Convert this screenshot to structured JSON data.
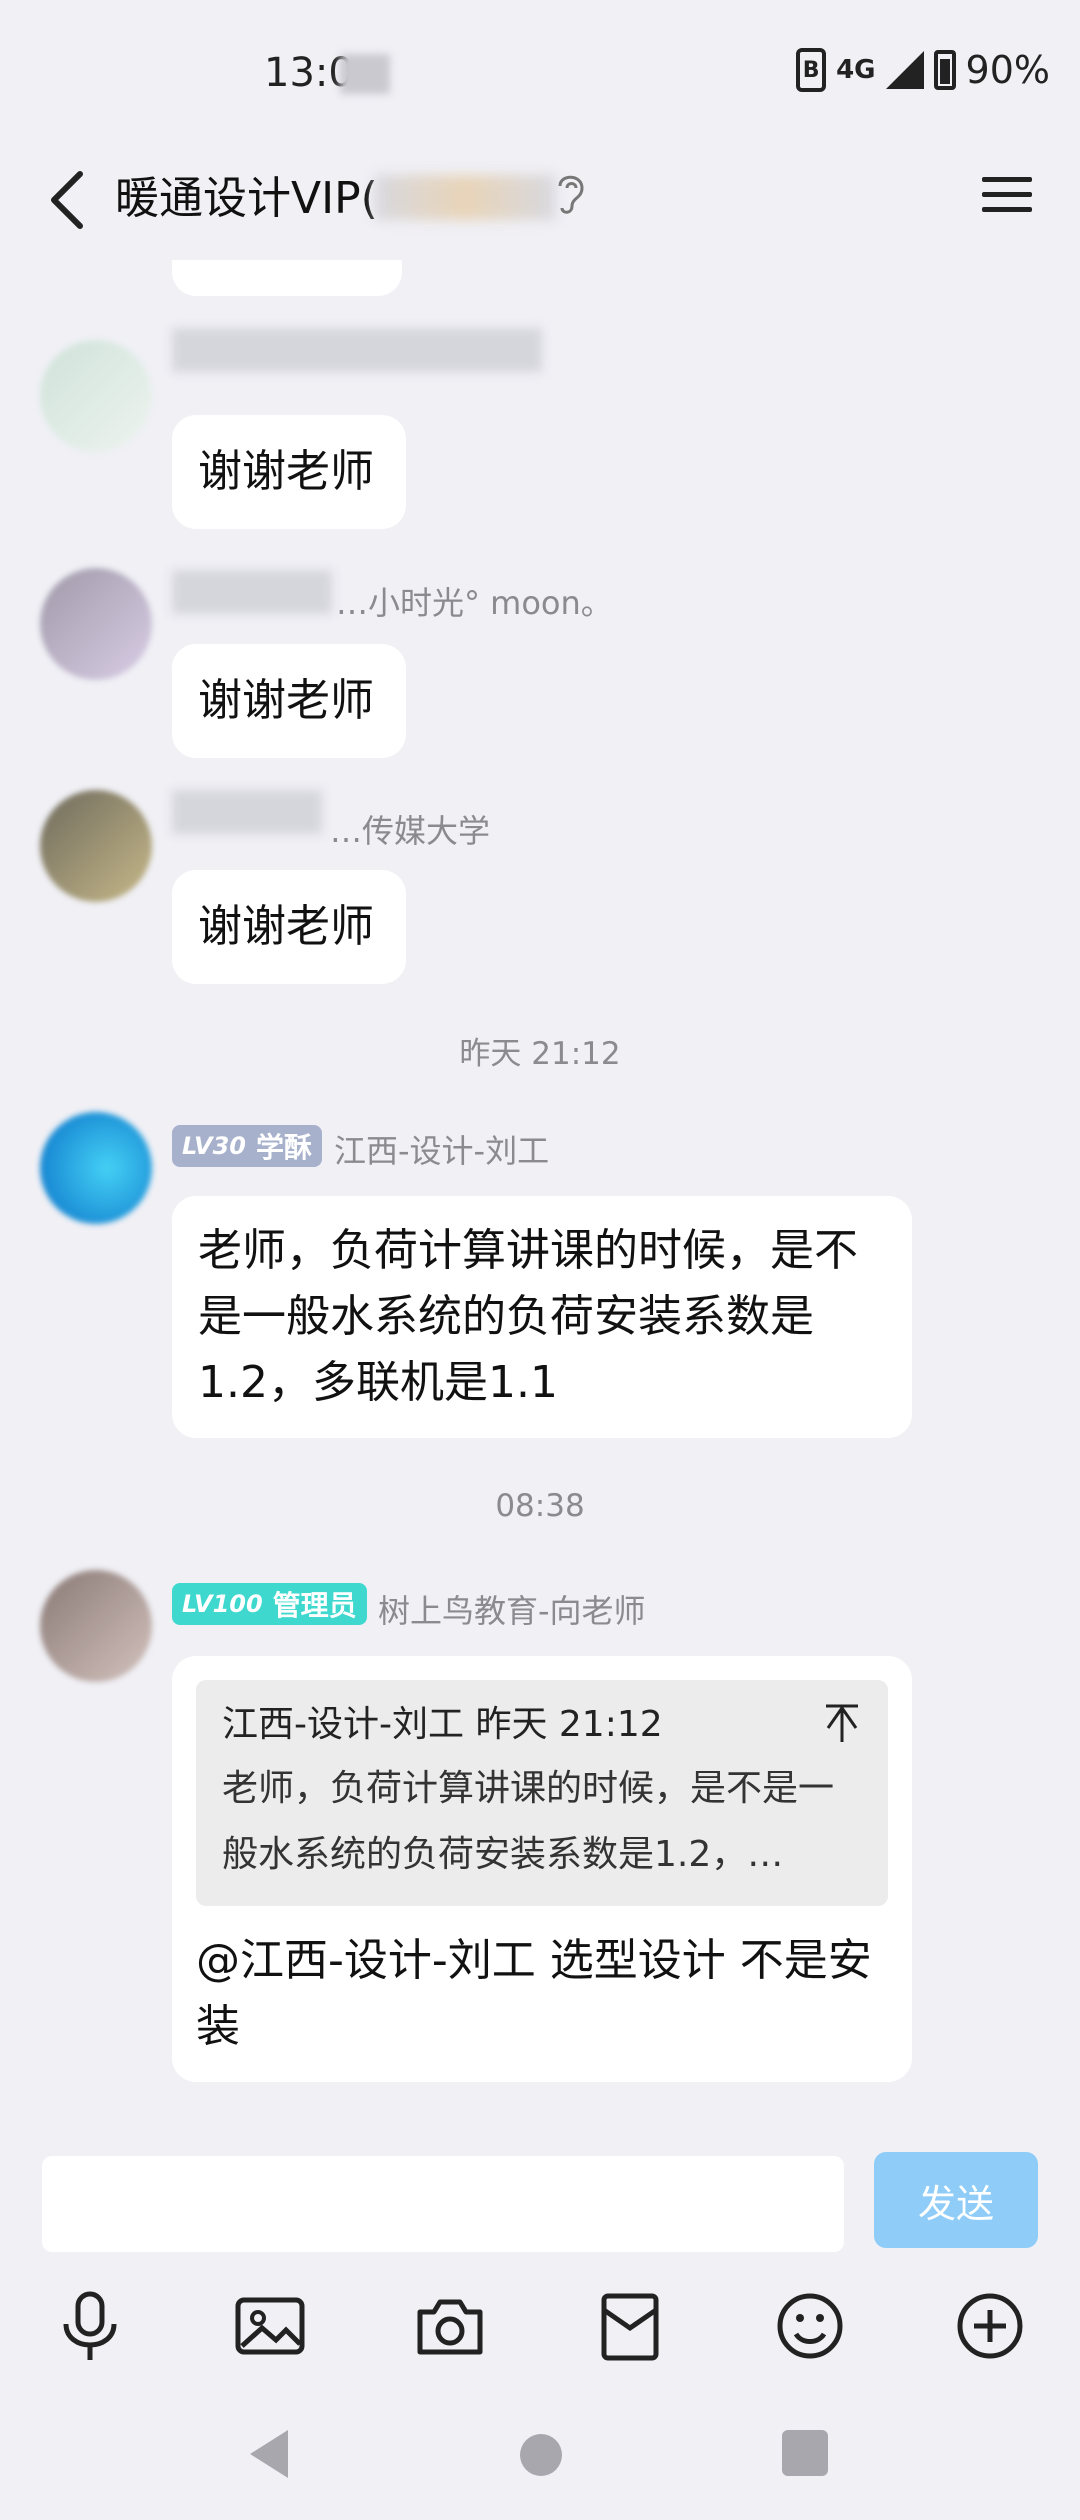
{
  "status": {
    "time": "13:0",
    "network": "4G",
    "battery": "90%"
  },
  "header": {
    "title": "暖通设计VIP("
  },
  "messages": [
    {
      "text": "谢谢老师"
    },
    {
      "sender_partial": "…小时光° moon。",
      "text": "谢谢老师"
    },
    {
      "sender_partial": "…传媒大学",
      "text": "谢谢老师"
    }
  ],
  "timestamps": [
    "昨天 21:12",
    "08:38"
  ],
  "message4": {
    "badge": {
      "level": "LV30",
      "title": "学酥"
    },
    "sender": "江西-设计-刘工",
    "text": "老师，负荷计算讲课的时候，是不是一般水系统的负荷安装系数是1.2，多联机是1.1"
  },
  "message5": {
    "badge": {
      "level": "LV100",
      "title": "管理员"
    },
    "sender": "树上鸟教育-向老师",
    "quote": {
      "author": "江西-设计-刘工",
      "time": "昨天 21:12",
      "text": "老师，负荷计算讲课的时候，是不是一般水系统的负荷安装系数是1.2，…"
    },
    "text": "@江西-设计-刘工 选型设计 不是安装"
  },
  "input": {
    "placeholder": "",
    "send_label": "发送"
  },
  "colors": {
    "send": "#8fcdf8",
    "badge_lv30": "#a7b1cc",
    "badge_lv100": "#3fd8cf"
  },
  "icons": [
    "microphone-icon",
    "image-icon",
    "camera-icon",
    "red-packet-icon",
    "emoji-icon",
    "plus-icon"
  ]
}
